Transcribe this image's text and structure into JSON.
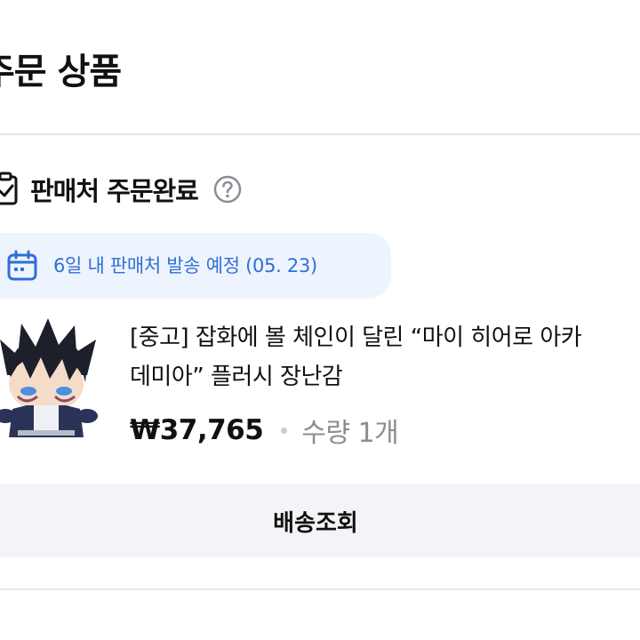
{
  "header": {
    "title": "주문 상품"
  },
  "order": {
    "status_label": "판매처 주문완료",
    "shipping_notice": "6일 내 판매처 발송 예정 (05. 23)"
  },
  "product": {
    "title": "[중고] 잡화에 볼 체인이 달린 “마이 히어로 아카\n데미아” 플러시 장난감",
    "price": "₩37,765",
    "quantity": "수량 1개"
  },
  "actions": {
    "track_label": "배송조회"
  },
  "icons": {
    "status": "clipboard-check-icon",
    "help": "question-circle-icon",
    "calendar": "calendar-icon",
    "thumbnail": "plush-toy-image"
  },
  "colors": {
    "accent_blue": "#2f6fd6",
    "chip_bg": "#eef4fd",
    "muted": "#8a8d93"
  }
}
